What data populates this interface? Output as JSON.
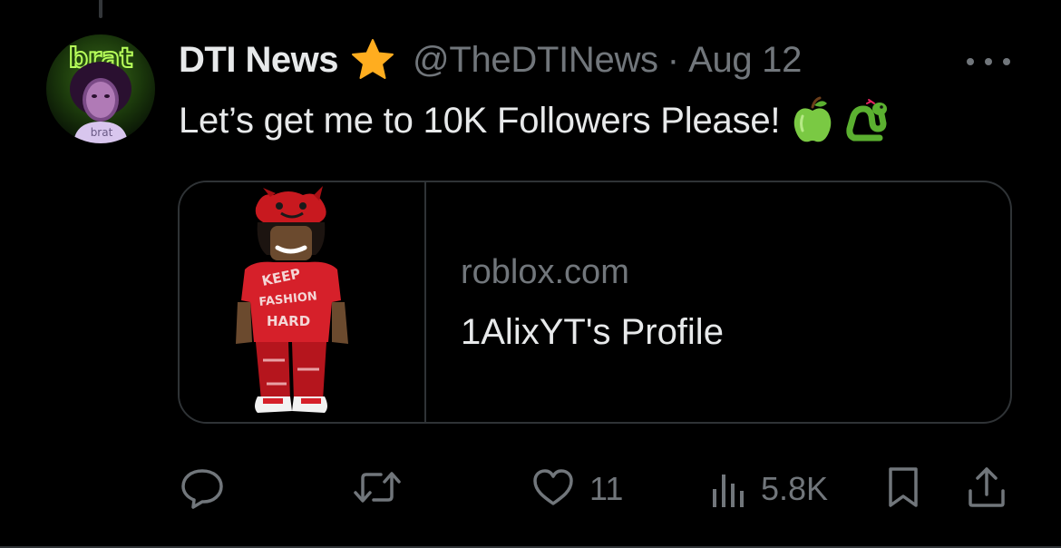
{
  "post": {
    "author": {
      "display_name": "DTI News",
      "handle": "@TheDTINews",
      "verified_badge_icon": "star-badge-icon",
      "avatar_shirt_text": "brat",
      "avatar_sign_text": "brat"
    },
    "separator": "·",
    "date": "Aug 12",
    "text": "Let’s get me to 10K Followers Please!",
    "emojis": [
      "green-apple-icon",
      "snake-icon"
    ],
    "more_icon": "more-horizontal-icon"
  },
  "link_card": {
    "domain": "roblox.com",
    "title": "1AlixYT's Profile",
    "media_shirt_text": [
      "KEEP",
      "FASHION",
      "HARD"
    ]
  },
  "actions": {
    "reply": {
      "icon": "reply-icon",
      "count": ""
    },
    "repost": {
      "icon": "repost-icon",
      "count": ""
    },
    "like": {
      "icon": "heart-icon",
      "count": "11"
    },
    "views": {
      "icon": "views-icon",
      "count": "5.8K"
    },
    "bookmark": {
      "icon": "bookmark-icon"
    },
    "share": {
      "icon": "share-icon"
    }
  },
  "colors": {
    "background": "#000000",
    "primary_text": "#e7e9ea",
    "secondary_text": "#71767b",
    "border": "#2f3336",
    "badge": "#ffad1f"
  }
}
